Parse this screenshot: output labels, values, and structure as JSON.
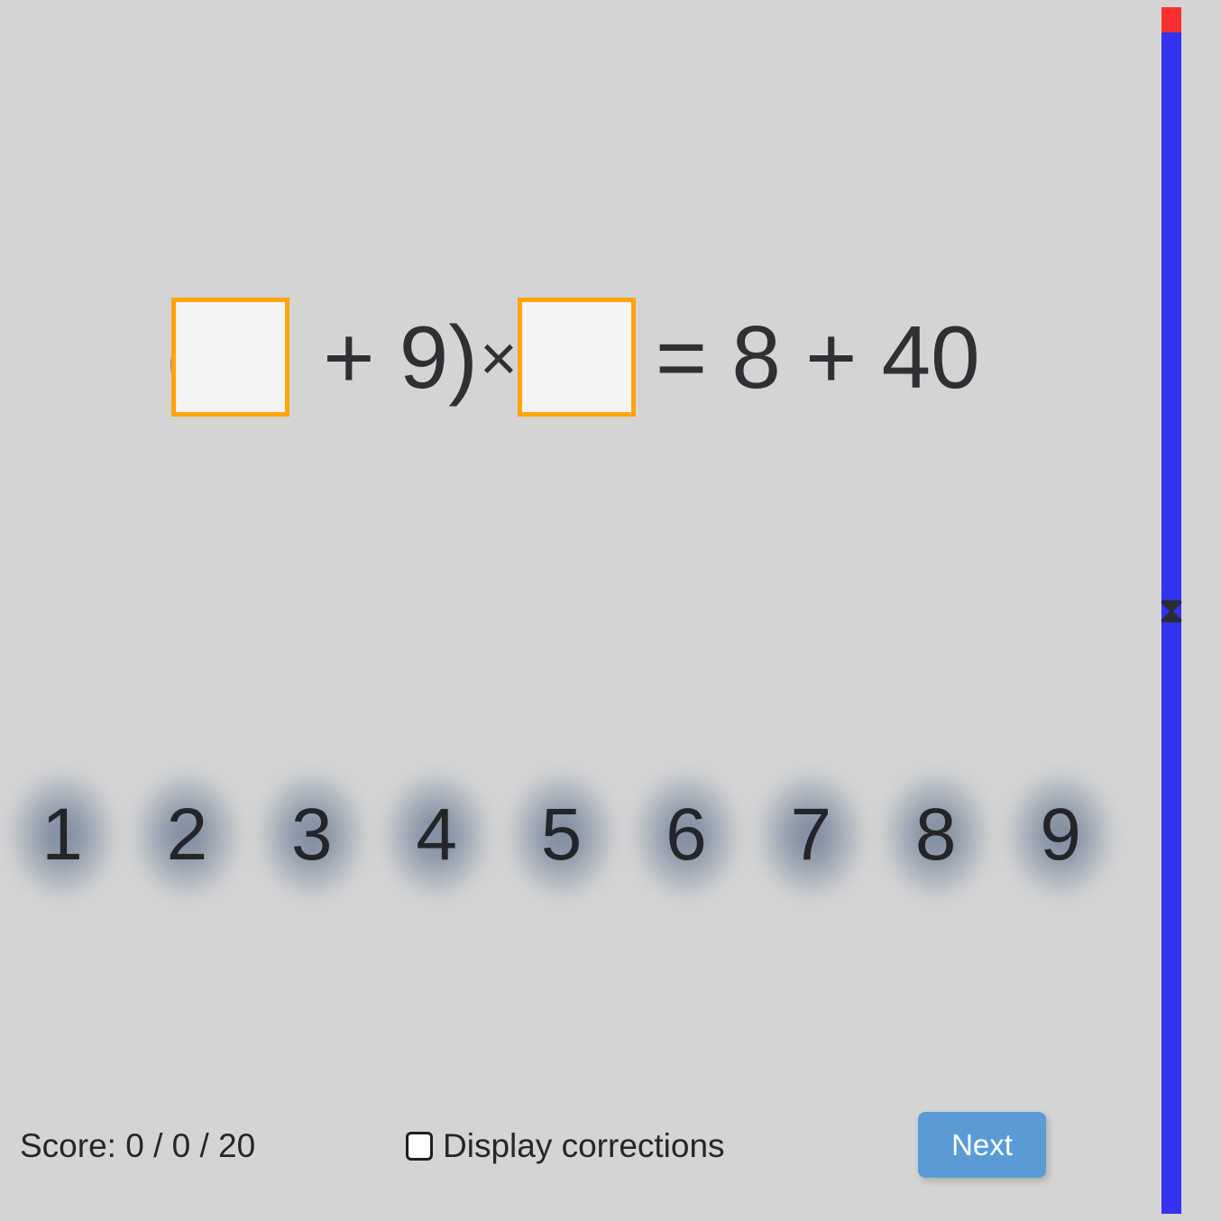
{
  "app": {
    "background_color": "#d4d4d4"
  },
  "equation": {
    "full_text": "( ___ + 9 ) × ___ = 8 + 40",
    "paren_open": "(",
    "blank_1": {
      "value": "",
      "placeholder": "",
      "border_color": "#ffa50a",
      "fill_color": "#f4f4f4"
    },
    "operator_1": " + 9)",
    "operator_mul": "×",
    "blank_2": {
      "value": "",
      "placeholder": "",
      "border_color": "#ffa50a",
      "fill_color": "#f4f4f4"
    },
    "right_side": "= 8 + 40"
  },
  "number_pad": {
    "keys": [
      {
        "label": "1"
      },
      {
        "label": "2"
      },
      {
        "label": "3"
      },
      {
        "label": "4"
      },
      {
        "label": "5"
      },
      {
        "label": "6"
      },
      {
        "label": "7"
      },
      {
        "label": "8"
      },
      {
        "label": "9"
      }
    ]
  },
  "footer": {
    "score_text": "Score: 0 / 0 / 20",
    "score": {
      "correct": 0,
      "answered": 0,
      "total": 20
    },
    "corrections_label": "Display corrections",
    "corrections_checked": false,
    "next_label": "Next",
    "next_color": "#5b9bd5"
  },
  "timer": {
    "elapsed_color": "#fa3030",
    "remaining_color": "#3333f0",
    "handle_icon": "hourglass-icon",
    "handle_glyph": "⧗"
  }
}
